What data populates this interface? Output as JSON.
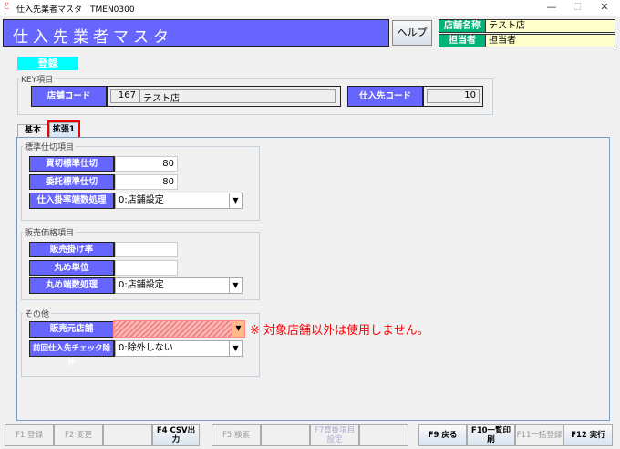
{
  "window": {
    "title": "仕入先業者マスタ　TMEN0300",
    "minimize": "—",
    "maximize": "☐",
    "close": "✕"
  },
  "header": {
    "title": "仕入先業者マスタ",
    "help_label": "ヘルプ",
    "store_name_label": "店舗名称",
    "store_name_value": "テスト店",
    "staff_label": "担当者",
    "staff_value": "担当者"
  },
  "mode_label": "登録",
  "key": {
    "group_label": "KEY項目",
    "store_code_label": "店舗コード",
    "store_code": "167",
    "store_name": "テスト店",
    "supplier_code_label": "仕入先コード",
    "supplier_code": "10"
  },
  "tabs": [
    {
      "label": "基本",
      "active": false
    },
    {
      "label": "拡張1",
      "active": true
    }
  ],
  "standard": {
    "group_label": "標準仕切項目",
    "rows": [
      {
        "label": "買切標準仕切",
        "value": "80"
      },
      {
        "label": "委託標準仕切",
        "value": "80"
      },
      {
        "label": "仕入掛率端数処理",
        "value": "0:店舗設定"
      }
    ]
  },
  "sales": {
    "group_label": "販売価格項目",
    "rows": [
      {
        "label": "販売掛け率",
        "value": ""
      },
      {
        "label": "丸め単位",
        "value": ""
      },
      {
        "label": "丸め端数処理",
        "value": "0:店舗設定"
      }
    ]
  },
  "other": {
    "group_label": "その他",
    "rows": [
      {
        "label": "販売元店舗",
        "value": ""
      },
      {
        "label": "前回仕入先チェック除外",
        "value": "0:除外しない"
      }
    ],
    "note": "※ 対象店舗以外は使用しません。"
  },
  "colors": {
    "accent": "#6666ff",
    "highlight": "#00ffff",
    "note": "#ff0000",
    "label_green": "#00b377"
  },
  "fkeys": [
    {
      "label": "F1 登録",
      "enabled": false
    },
    {
      "label": "F2 変更",
      "enabled": false
    },
    {
      "label": "",
      "enabled": false
    },
    {
      "label": "F4 CSV出力",
      "enabled": true
    },
    {
      "label": "F5 検索",
      "enabled": false
    },
    {
      "label": "",
      "enabled": false
    },
    {
      "label": "F7買掛項目設定",
      "enabled": false
    },
    {
      "label": "",
      "enabled": false
    },
    {
      "label": "F9 戻る",
      "enabled": true
    },
    {
      "label": "F10一覧印刷",
      "enabled": true
    },
    {
      "label": "F11一括登録",
      "enabled": false
    },
    {
      "label": "F12 実行",
      "enabled": true
    }
  ]
}
